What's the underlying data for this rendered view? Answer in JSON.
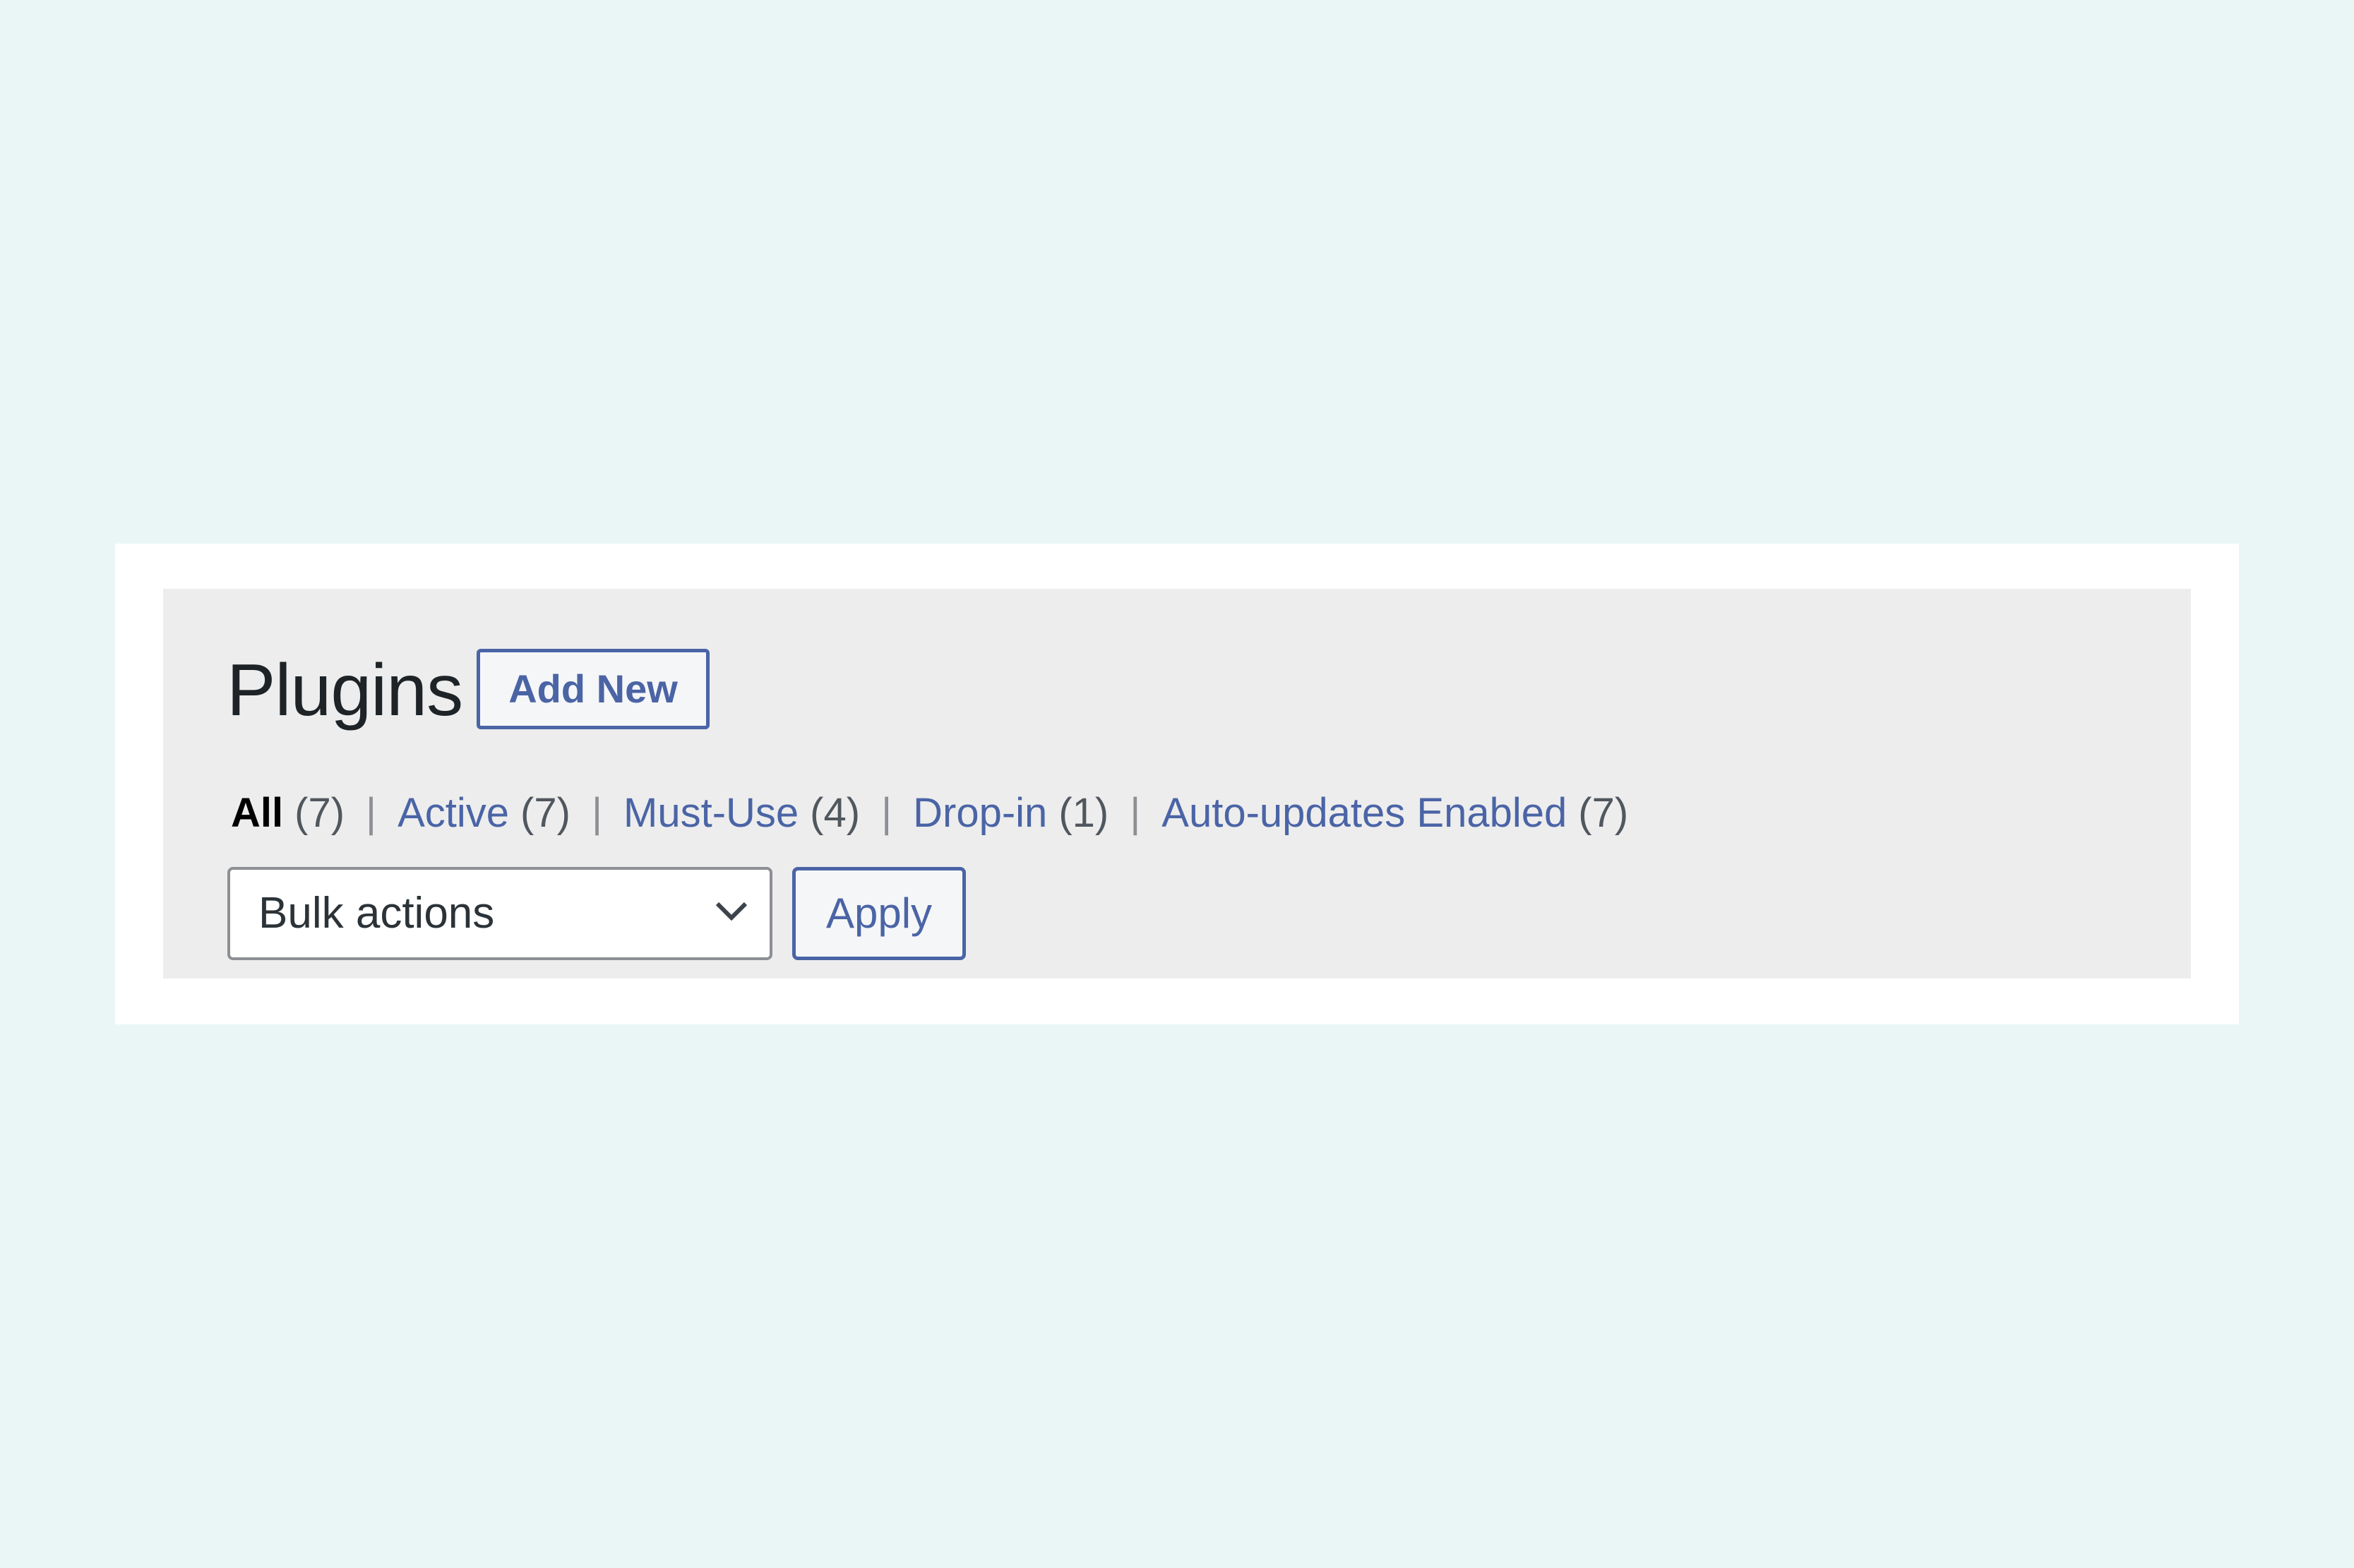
{
  "header": {
    "title": "Plugins",
    "add_new_label": "Add New"
  },
  "filters": [
    {
      "label": "All",
      "count": "(7)",
      "current": true
    },
    {
      "label": "Active",
      "count": "(7)",
      "current": false
    },
    {
      "label": "Must-Use",
      "count": "(4)",
      "current": false
    },
    {
      "label": "Drop-in",
      "count": "(1)",
      "current": false
    },
    {
      "label": "Auto-updates Enabled",
      "count": "(7)",
      "current": false
    }
  ],
  "filter_separator": "|",
  "bulk_actions": {
    "selected": "Bulk actions",
    "icon": "chevron-down-icon",
    "apply_label": "Apply"
  },
  "colors": {
    "page_background": "#eaf5f6",
    "frame": "#ffffff",
    "panel": "#ededed",
    "link": "#4a64a6",
    "title": "#1d2327",
    "count": "#50575e",
    "select_border": "#8c8f94"
  }
}
